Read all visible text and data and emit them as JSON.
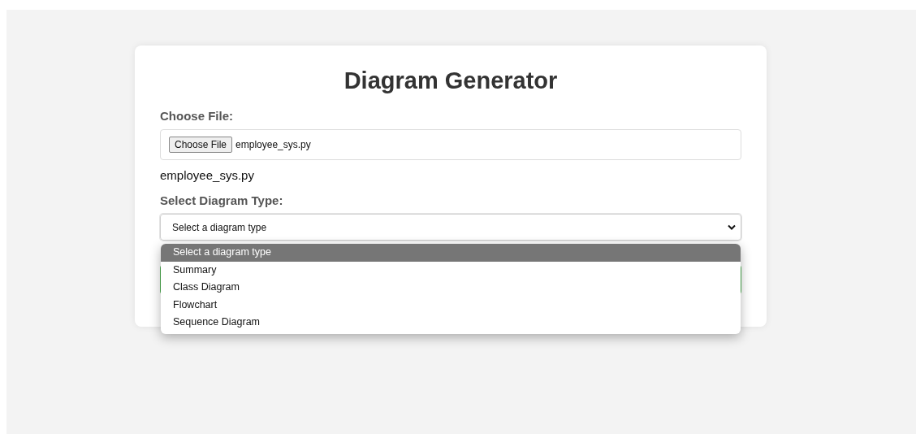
{
  "title": "Diagram Generator",
  "file_section": {
    "label": "Choose File:",
    "button": "Choose File",
    "file_name": "employee_sys.py",
    "selected_file": "employee_sys.py"
  },
  "diagram_section": {
    "label": "Select Diagram Type:",
    "value": "Select a diagram type",
    "expanded": true,
    "options": [
      {
        "label": "Select a diagram type",
        "selected": true
      },
      {
        "label": "Summary",
        "selected": false
      },
      {
        "label": "Class Diagram",
        "selected": false
      },
      {
        "label": "Flowchart",
        "selected": false
      },
      {
        "label": "Sequence Diagram",
        "selected": false
      }
    ]
  }
}
